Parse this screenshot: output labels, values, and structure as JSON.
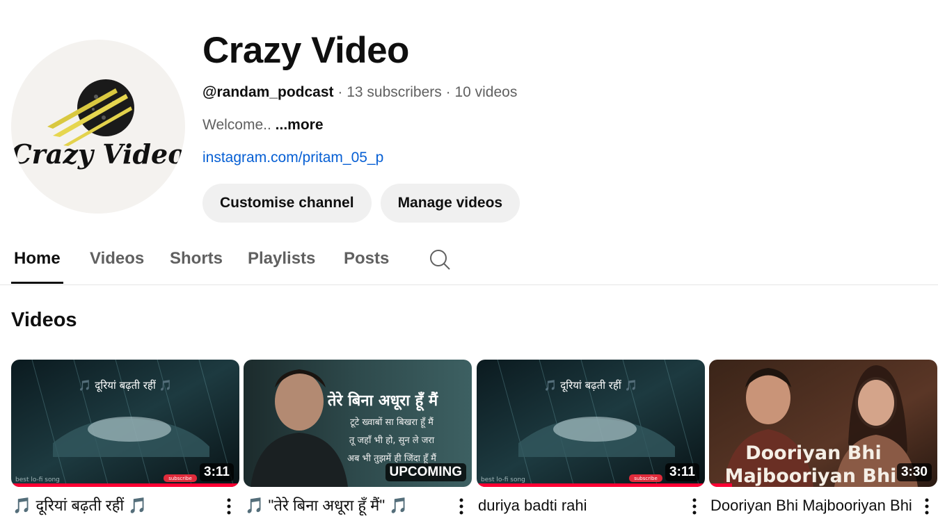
{
  "channel": {
    "avatar_label": "Crazy Video",
    "name": "Crazy Video",
    "handle": "@randam_podcast",
    "subscribers": "13 subscribers",
    "videos_count": "10 videos",
    "separator": " · ",
    "description": "Welcome..",
    "more_label": "...more",
    "link": "instagram.com/pritam_05_p",
    "buttons": {
      "customise": "Customise channel",
      "manage": "Manage videos"
    }
  },
  "tabs": [
    {
      "label": "Home",
      "active": true
    },
    {
      "label": "Videos",
      "active": false
    },
    {
      "label": "Shorts",
      "active": false
    },
    {
      "label": "Playlists",
      "active": false
    },
    {
      "label": "Posts",
      "active": false
    }
  ],
  "section": {
    "title": "Videos"
  },
  "videos": [
    {
      "title": "🎵 दूरियां बढ़ती रहीं 🎵",
      "badge": "3:11",
      "thumb_text": "🎵 दूरियां बढ़ती रहीं 🎵",
      "thumb_corner": "best lo-fi song",
      "thumb_sub": "subscribe",
      "progress": 1.0
    },
    {
      "title": "🎵 \"तेरे बिना अधूरा हूँ मैं\" 🎵",
      "badge": "UPCOMING",
      "thumb_lines": [
        "तेरे बिना अधूरा हूँ मैं",
        "टूटे ख्वाबों सा बिखरा हूँ मैं",
        "तू जहाँ भी हो, सुन ले जरा",
        "अब भी तुझमें ही जिंदा हूँ मैं"
      ],
      "progress": 0
    },
    {
      "title": "duriya badti rahi",
      "badge": "3:11",
      "thumb_text": "🎵 दूरियां बढ़ती रहीं 🎵",
      "thumb_corner": "best lo-fi song",
      "thumb_sub": "subscribe",
      "progress": 1.0
    },
    {
      "title": "Dooriyan Bhi Majbooriyan Bhi",
      "badge": "3:30",
      "thumb_lines": [
        "Dooriyan Bhi",
        "Majbooriyan Bhi"
      ],
      "progress": 0.1
    }
  ],
  "colors": {
    "accent_link": "#065fd4",
    "progress_red": "#ff0033",
    "button_bg": "#f0f0f0"
  }
}
